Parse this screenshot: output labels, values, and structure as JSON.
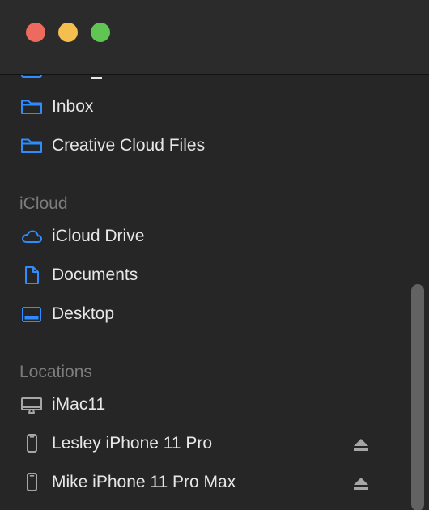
{
  "window": {
    "controls": [
      "close",
      "minimize",
      "zoom"
    ]
  },
  "sidebar": {
    "favorites": [
      {
        "label": "Inbox",
        "icon": "folder-icon"
      },
      {
        "label": "Creative Cloud Files",
        "icon": "folder-icon"
      }
    ],
    "icloud": {
      "header": "iCloud",
      "items": [
        {
          "label": "iCloud Drive",
          "icon": "cloud-icon"
        },
        {
          "label": "Documents",
          "icon": "document-icon"
        },
        {
          "label": "Desktop",
          "icon": "desktop-icon"
        }
      ]
    },
    "locations": {
      "header": "Locations",
      "items": [
        {
          "label": "iMac11",
          "icon": "imac-icon"
        },
        {
          "label": "Lesley iPhone 11 Pro",
          "icon": "iphone-icon",
          "eject": "eject-icon"
        },
        {
          "label": "Mike iPhone 11 Pro Max",
          "icon": "iphone-icon",
          "eject": "eject-icon"
        }
      ]
    }
  },
  "colors": {
    "background": "#262626",
    "titlebar": "#2b2b2b",
    "accent": "#2f8cff",
    "text": "#e7e7e7",
    "section_text": "#7d7d7d",
    "close": "#ed6a5e",
    "minimize": "#f5bf4f",
    "zoom": "#61c554"
  }
}
